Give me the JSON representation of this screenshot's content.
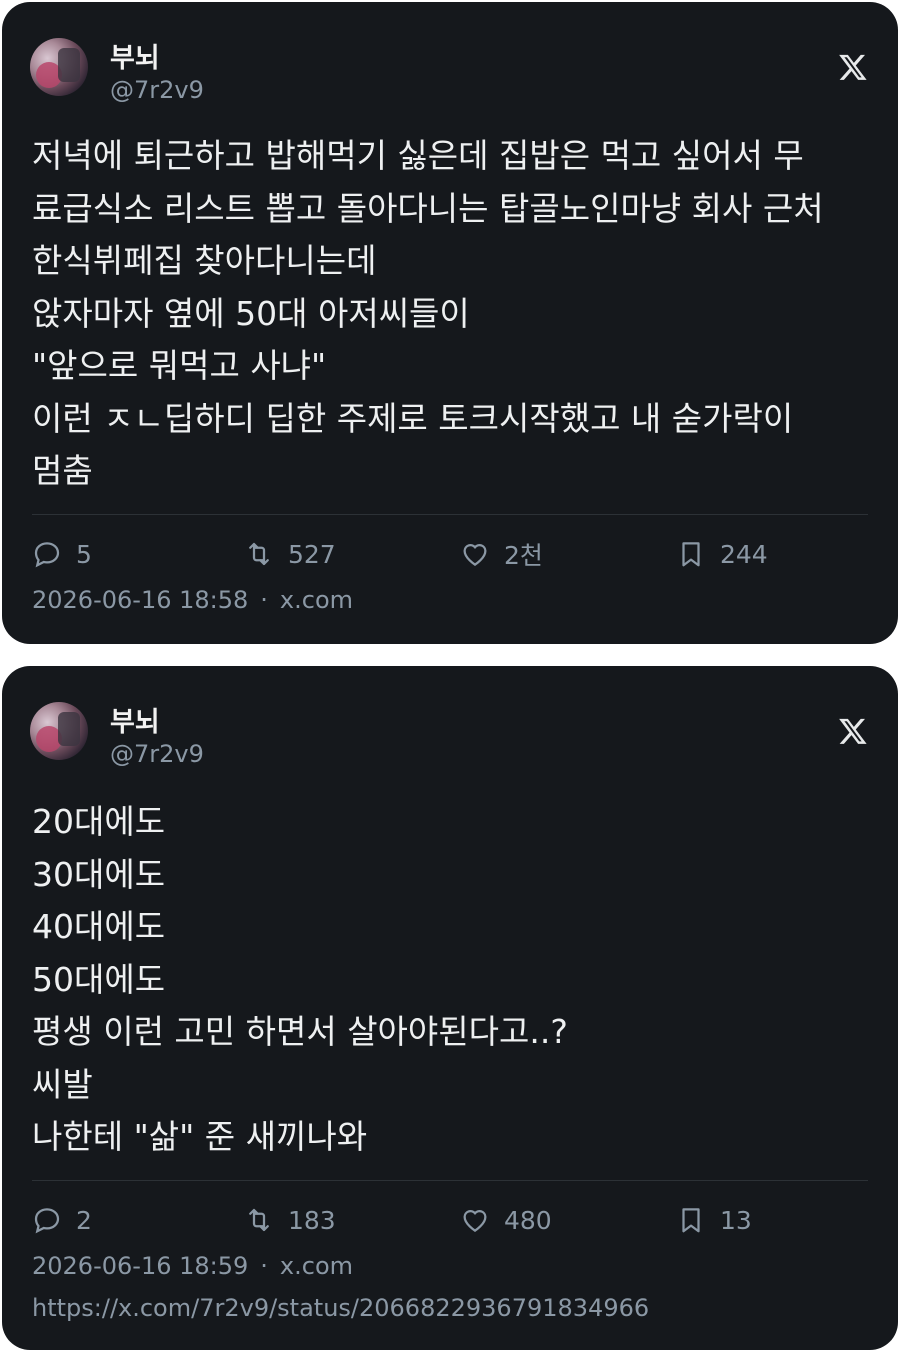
{
  "tweets": [
    {
      "author": {
        "name": "부뇌",
        "handle": "@7r2v9"
      },
      "text": "저녁에 퇴근하고 밥해먹기 싫은데 집밥은 먹고 싶어서 무\n료급식소 리스트 뽑고 돌아다니는 탑골노인마냥 회사 근처\n한식뷔페집 찾아다니는데\n앉자마자 옆에 50대 아저씨들이\n\"앞으로 뭐먹고 사냐\"\n이런 ㅈㄴ딥하디 딥한 주제로 토크시작했고 내 숟가락이\n멈춤",
      "stats": {
        "replies": "5",
        "retweets": "527",
        "likes": "2천",
        "bookmarks": "244"
      },
      "timestamp": "2026-06-16 18:58",
      "source": "x.com"
    },
    {
      "author": {
        "name": "부뇌",
        "handle": "@7r2v9"
      },
      "text": "20대에도\n30대에도\n40대에도\n50대에도\n평생 이런 고민 하면서 살아야된다고..?\n씨발\n나한테 \"삶\" 준 새끼나와",
      "stats": {
        "replies": "2",
        "retweets": "183",
        "likes": "480",
        "bookmarks": "13"
      },
      "timestamp": "2026-06-16 18:59",
      "source": "x.com",
      "url": "https://x.com/7r2v9/status/2066822936791834966"
    }
  ],
  "icons": {
    "platform": "x-logo-icon",
    "reply": "reply-icon",
    "retweet": "retweet-icon",
    "like": "heart-icon",
    "bookmark": "bookmark-icon"
  },
  "colors": {
    "card_bg": "#15181c",
    "text": "#e7e9ea",
    "muted": "#8b98a5"
  }
}
